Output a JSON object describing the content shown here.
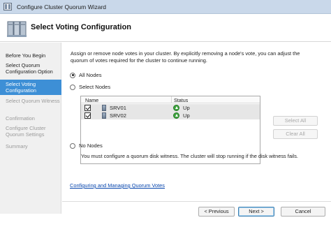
{
  "window": {
    "title": "Configure Cluster Quorum Wizard"
  },
  "header": {
    "title": "Select Voting Configuration"
  },
  "sidebar": {
    "steps": [
      {
        "label": "Before You Begin"
      },
      {
        "label": "Select Quorum Configuration Option"
      },
      {
        "label": "Select Voting Configuration"
      },
      {
        "label": "Select Quorum Witness"
      },
      {
        "label": "Confirmation"
      },
      {
        "label": "Configure Cluster Quorum Settings"
      },
      {
        "label": "Summary"
      }
    ]
  },
  "main": {
    "description": "Assign or remove node votes in your cluster. By explicitly removing a node's vote, you can adjust the quorum of votes required for the cluster to continue running.",
    "options": {
      "all_nodes": "All Nodes",
      "select_nodes": "Select Nodes",
      "no_nodes": "No Nodes"
    },
    "selected_option": "All Nodes",
    "table": {
      "columns": [
        "Name",
        "Status"
      ],
      "rows": [
        {
          "name": "SRV01",
          "status": "Up",
          "checked": true
        },
        {
          "name": "SRV02",
          "status": "Up",
          "checked": true
        }
      ]
    },
    "select_all": "Select All",
    "clear_all": "Clear All",
    "witness_note": "You must configure a quorum disk witness. The cluster will stop running if the disk witness fails.",
    "link": "Configuring and Managing Quorum Votes"
  },
  "footer": {
    "previous": "< Previous",
    "next": "Next >",
    "cancel": "Cancel"
  },
  "colors": {
    "active_step": "#3d8fd6",
    "link": "#0645ad",
    "status_up": "#3ea33e"
  }
}
